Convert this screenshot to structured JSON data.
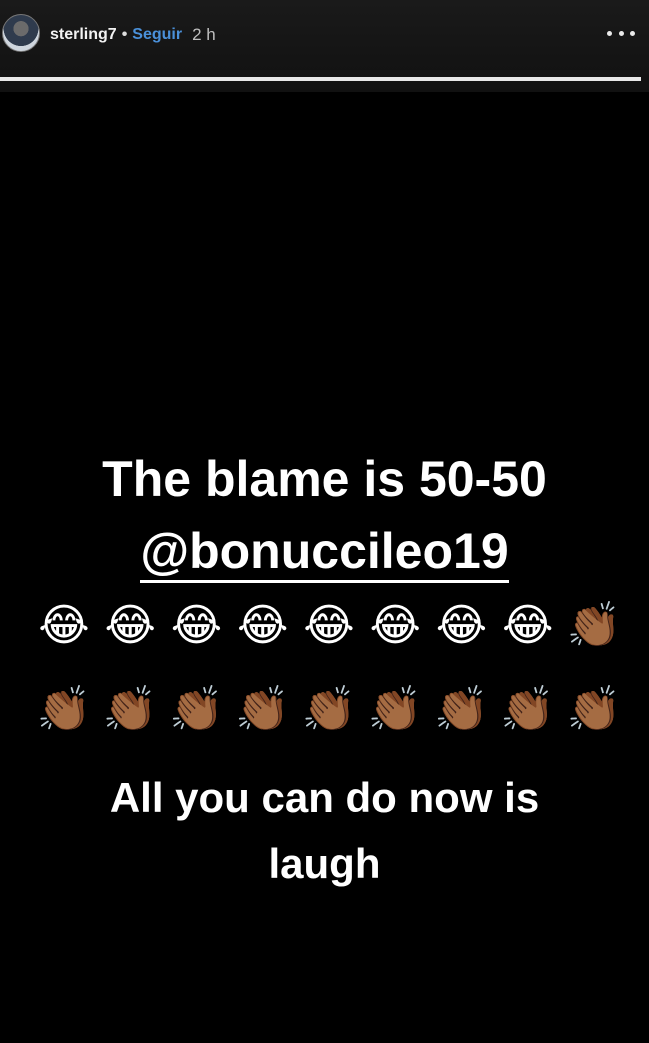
{
  "header": {
    "username": "sterling7",
    "separator": "•",
    "follow_label": "Seguir",
    "timestamp": "2 h",
    "more_icon": "more-horizontal-icon",
    "progress_fraction": 1.0
  },
  "story": {
    "line1": "The blame is 50-50",
    "mention": "@bonuccileo19",
    "emoji_row1": [
      "😂",
      "😂",
      "😂",
      "😂",
      "😂",
      "😂",
      "😂",
      "😂",
      "👏🏾"
    ],
    "emoji_row2": [
      "👏🏾",
      "👏🏾",
      "👏🏾",
      "👏🏾",
      "👏🏾",
      "👏🏾",
      "👏🏾",
      "👏🏾",
      "👏🏾"
    ],
    "line3": "All you can do now is",
    "line4": "laugh"
  },
  "colors": {
    "background": "#000000",
    "follow_link": "#4a90d9",
    "text": "#ffffff"
  }
}
